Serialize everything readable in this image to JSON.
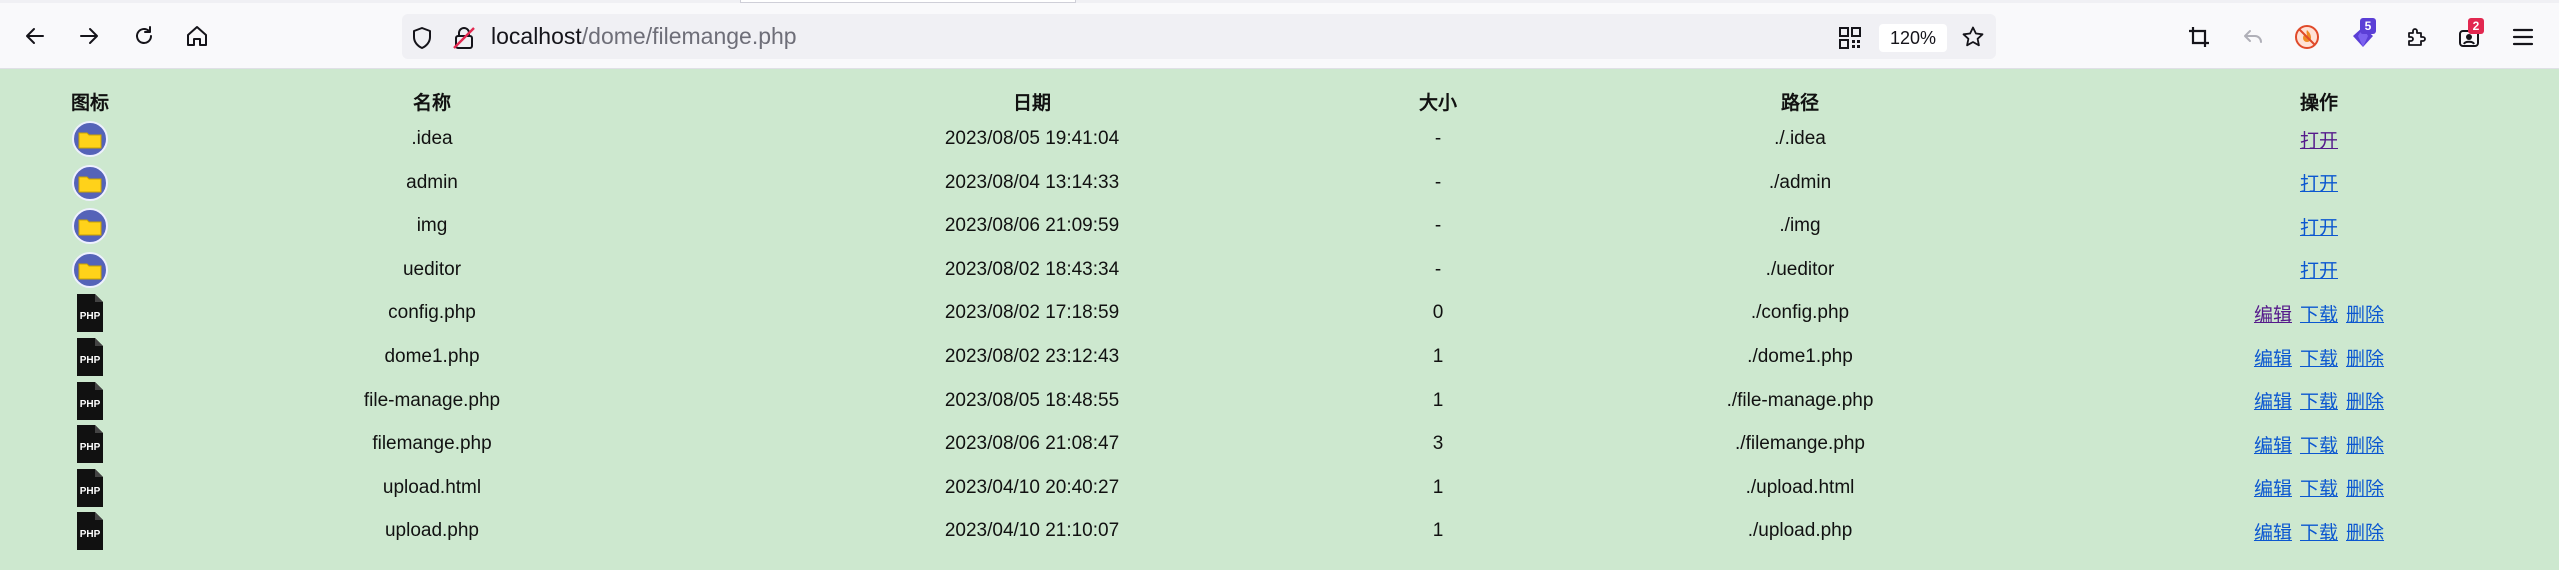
{
  "browser": {
    "url_host": "localhost",
    "url_path": "/dome/filemange.php",
    "zoom": "120%",
    "extension_badges": [
      "5",
      "2"
    ]
  },
  "table": {
    "headers": {
      "icon": "图标",
      "name": "名称",
      "date": "日期",
      "size": "大小",
      "path": "路径",
      "actions": "操作"
    },
    "rows": [
      {
        "type": "folder",
        "name": ".idea",
        "date": "2023/08/05 19:41:04",
        "size": "-",
        "path": "./.idea",
        "actions": [
          "打开"
        ]
      },
      {
        "type": "folder",
        "name": "admin",
        "date": "2023/08/04 13:14:33",
        "size": "-",
        "path": "./admin",
        "actions": [
          "打开"
        ]
      },
      {
        "type": "folder",
        "name": "img",
        "date": "2023/08/06 21:09:59",
        "size": "-",
        "path": "./img",
        "actions": [
          "打开"
        ]
      },
      {
        "type": "folder",
        "name": "ueditor",
        "date": "2023/08/02 18:43:34",
        "size": "-",
        "path": "./ueditor",
        "actions": [
          "打开"
        ]
      },
      {
        "type": "php",
        "name": "config.php",
        "date": "2023/08/02 17:18:59",
        "size": "0",
        "path": "./config.php",
        "actions": [
          "编辑",
          "下载",
          "删除"
        ]
      },
      {
        "type": "php",
        "name": "dome1.php",
        "date": "2023/08/02 23:12:43",
        "size": "1",
        "path": "./dome1.php",
        "actions": [
          "编辑",
          "下载",
          "删除"
        ]
      },
      {
        "type": "php",
        "name": "file-manage.php",
        "date": "2023/08/05 18:48:55",
        "size": "1",
        "path": "./file-manage.php",
        "actions": [
          "编辑",
          "下载",
          "删除"
        ]
      },
      {
        "type": "php",
        "name": "filemange.php",
        "date": "2023/08/06 21:08:47",
        "size": "3",
        "path": "./filemange.php",
        "actions": [
          "编辑",
          "下载",
          "删除"
        ]
      },
      {
        "type": "php",
        "name": "upload.html",
        "date": "2023/04/10 20:40:27",
        "size": "1",
        "path": "./upload.html",
        "actions": [
          "编辑",
          "下载",
          "删除"
        ]
      },
      {
        "type": "php",
        "name": "upload.php",
        "date": "2023/04/10 21:10:07",
        "size": "1",
        "path": "./upload.php",
        "actions": [
          "编辑",
          "下载",
          "删除"
        ]
      }
    ]
  },
  "icons": {
    "folder_row": "folder-icon",
    "php_row": "php-file-icon",
    "php_label": "PHP"
  },
  "colors": {
    "page_background": "#cde8cf",
    "link": "#0b57d0",
    "link_visited": "#551a8b",
    "folder_circle": "#5563b8",
    "folder_fill": "#ffd21a"
  }
}
